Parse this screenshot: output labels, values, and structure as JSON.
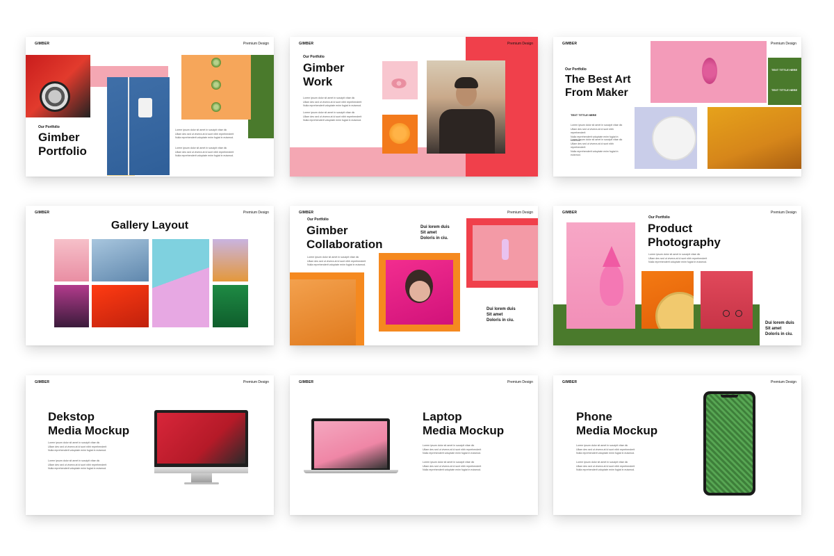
{
  "common": {
    "brand": "GIMBER",
    "premium": "Premium Design",
    "lorem_lines": [
      "Lorem ipsum dolor sit amet in suscipit vitae dic",
      "Ullam des sed ut viverra at id sunt nibh reprehenderit",
      "Nulla reprehenderit voluptate enim fugiat in euismod.",
      "Eu lorem dolor amet eiusmod etiam pharetra."
    ]
  },
  "slides": [
    {
      "subtitle": "Our Portfolio",
      "title": "Gimber\nPortfolio"
    },
    {
      "subtitle": "Our Portfolio",
      "title": "Gimber\nWork"
    },
    {
      "subtitle": "Our Portfolio",
      "title": "The Best Art\nFrom Maker",
      "text_title": "TEXT TITTLE HERE",
      "tag1": "TEXT TITTLE HERE",
      "tag2": "TEXT TITTLE HERE"
    },
    {
      "title": "Gallery Layout"
    },
    {
      "subtitle": "Our Portfolio",
      "title": "Gimber\nCollaboration",
      "side1": "Dui lorem duis\nSit amet\nDoloris in ciu.",
      "side2": "Dui lorem duis\nSit amet\nDoloris in ciu."
    },
    {
      "subtitle": "Our Portfolio",
      "title": "Product\nPhotography",
      "side1": "Dui lorem duis\nSit amet\nDoloris in ciu."
    },
    {
      "title": "Dekstop\nMedia Mockup"
    },
    {
      "title": "Laptop\nMedia Mockup"
    },
    {
      "title": "Phone\nMedia Mockup"
    }
  ],
  "colors": {
    "red": "#f0404b",
    "pink": "#f4a7b3",
    "green": "#4a7a2c",
    "orange": "#f5891f",
    "yellow": "#f6d88d",
    "blue": "#3c6fa8"
  },
  "icons": [
    "car-wheel-photo",
    "chair-photo",
    "sprout-photo",
    "man-portrait-photo",
    "grapes-photo",
    "sofa-photo",
    "monitor-mockup",
    "laptop-mockup",
    "phone-mockup"
  ]
}
